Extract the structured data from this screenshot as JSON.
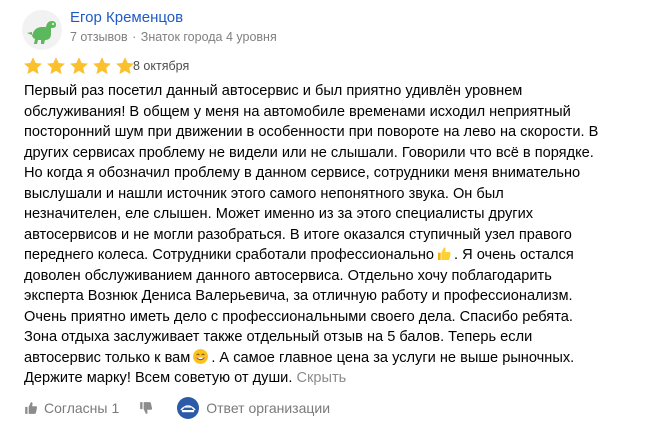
{
  "author": {
    "name": "Егор Кременцов",
    "reviews": "7 отзывов",
    "separator": "·",
    "level": "Знаток города 4 уровня",
    "avatar_icon": "dinosaur-icon"
  },
  "rating": {
    "value": 5,
    "max": 5,
    "star_color": "#fbc02d"
  },
  "date": "8 октября",
  "review_lines": [
    "Первый раз посетил данный автосервис и был приятно удивлён уровнем",
    "обслуживания! В общем у меня на автомобиле временами исходил неприятный",
    "посторонний шум при движении в особенности при повороте на лево на скорости. В",
    "других сервисах проблему не видели или не слышали. Говорили что всё в порядке.",
    "Но когда я обозначил проблему в данном сервисе, сотрудники меня внимательно",
    "выслушали и нашли источник этого самого непонятного звука. Он был",
    "незначителен, еле слышен. Может именно из за этого специалисты других",
    "автосервисов и не могли разобраться. В итоге оказался ступичный узел правого",
    "переднего колеса. Сотрудники сработали профессионально",
    ". Я очень остался",
    "доволен обслуживанием данного автосервиса. Отдельно хочу поблагодарить",
    "эксперта Вознюк Дениса Валерьевича, за отличную работу и профессионализм.",
    "Очень приятно иметь дело с профессиональными своего дела. Спасибо ребята.",
    "Зона отдыха заслуживает также отдельный отзыв на 5 балов. Теперь если",
    "автосервис только к вам",
    ". А самое главное цена за услуги не выше рыночных.",
    "Держите марку! Всем советую от души."
  ],
  "emoji": {
    "thumbs_up": "thumbs-up-emoji",
    "smile": "smiling-face-emoji"
  },
  "collapse_label": "Скрыть",
  "footer": {
    "like_label": "Согласны",
    "like_count": "1",
    "like_icon": "thumbs-up-icon",
    "dislike_icon": "thumbs-down-icon",
    "org_reply_label": "Ответ организации",
    "org_logo_icon": "organization-logo-icon"
  }
}
